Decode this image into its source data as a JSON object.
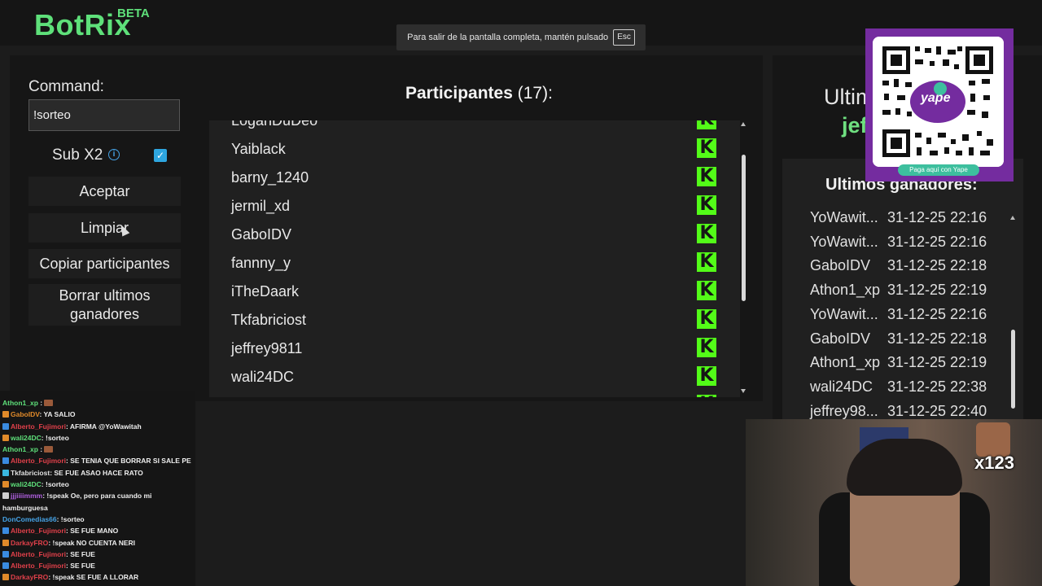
{
  "header": {
    "logo": "BotRix",
    "logo_badge": "BETA"
  },
  "fullscreen_notice": {
    "text": "Para salir de la pantalla completa, mantén pulsado",
    "key": "Esc"
  },
  "command": {
    "label": "Command:",
    "value": "!sorteo"
  },
  "sub_x2": {
    "label": "Sub X2",
    "info_icon": "info-icon",
    "checked": true
  },
  "buttons": {
    "aceptar": "Aceptar",
    "limpiar": "Limpiar",
    "copiar": "Copiar participantes",
    "borrar": "Borrar ultimos ganadores"
  },
  "participants": {
    "title": "Participantes",
    "count": "(17):",
    "items": [
      {
        "name": "LoganDuDeo"
      },
      {
        "name": "Yaiblack"
      },
      {
        "name": "barny_1240"
      },
      {
        "name": "jermil_xd"
      },
      {
        "name": "GaboIDV"
      },
      {
        "name": "fannny_y"
      },
      {
        "name": "iTheDaark"
      },
      {
        "name": "Tkfabriciost"
      },
      {
        "name": "jeffrey9811"
      },
      {
        "name": "wali24DC"
      }
    ],
    "platform_icon": "kick-icon",
    "platform_glyph": "K"
  },
  "right": {
    "ultim_heading": "Ultim",
    "winner_name": "jef"
  },
  "qr": {
    "pay_label": "Paga aquí con Yape",
    "brand": "yape"
  },
  "winners": {
    "title": "Ultimos ganadores:",
    "rows": [
      {
        "name": "YoWawit...",
        "date": "31-12-25 22:16"
      },
      {
        "name": "YoWawit...",
        "date": "31-12-25 22:16"
      },
      {
        "name": "GaboIDV",
        "date": "31-12-25 22:18"
      },
      {
        "name": "Athon1_xp",
        "date": "31-12-25 22:19"
      },
      {
        "name": "YoWawit...",
        "date": "31-12-25 22:16"
      },
      {
        "name": "GaboIDV",
        "date": "31-12-25 22:18"
      },
      {
        "name": "Athon1_xp",
        "date": "31-12-25 22:19"
      },
      {
        "name": "wali24DC",
        "date": "31-12-25 22:38"
      },
      {
        "name": "jeffrey98...",
        "date": "31-12-25 22:40"
      }
    ]
  },
  "chat": [
    {
      "user": "Athon1_xp",
      "color": "#5ee07a",
      "badge": "",
      "msg": "",
      "emote": true
    },
    {
      "user": "GaboIDV",
      "color": "#e08a2a",
      "badge": "orange",
      "msg": ": YA SALIO"
    },
    {
      "user": "Alberto_Fujimori",
      "color": "#e0404a",
      "badge": "blue",
      "msg": ": AFIRMA @YoWawitah"
    },
    {
      "user": "wali24DC",
      "color": "#5ee07a",
      "badge": "orange",
      "msg": ": !sorteo"
    },
    {
      "user": "Athon1_xp",
      "color": "#5ee07a",
      "badge": "",
      "msg": "",
      "emote": true
    },
    {
      "user": "Alberto_Fujimori",
      "color": "#e0404a",
      "badge": "blue",
      "msg": ": SE TENIA QUE BORRAR SI SALE PE"
    },
    {
      "user": "Tkfabriciost",
      "color": "#e0e0e0",
      "badge": "cyan",
      "msg": ": SE FUE ASAO HACE RATO"
    },
    {
      "user": "wali24DC",
      "color": "#5ee07a",
      "badge": "orange",
      "msg": ": !sorteo"
    },
    {
      "user": "jjjiiiimmm",
      "color": "#b060e0",
      "badge": "white",
      "msg": ": !speak Oe, pero para cuando mi"
    },
    {
      "user": "",
      "color": "#e0e0e0",
      "badge": "",
      "msg": "hamburguesa"
    },
    {
      "user": "DonComedias66",
      "color": "#46a3e6",
      "badge": "",
      "msg": ": !sorteo"
    },
    {
      "user": "Alberto_Fujimori",
      "color": "#e0404a",
      "badge": "blue",
      "msg": ": SE FUE MANO"
    },
    {
      "user": "DarkayFRO",
      "color": "#e0404a",
      "badge": "orange",
      "msg": ": !speak NO CUENTA NERI"
    },
    {
      "user": "Alberto_Fujimori",
      "color": "#e0404a",
      "badge": "blue",
      "msg": ": SE FUE"
    },
    {
      "user": "Alberto_Fujimori",
      "color": "#e0404a",
      "badge": "blue",
      "msg": ": SE FUE"
    },
    {
      "user": "DarkayFRO",
      "color": "#e0404a",
      "badge": "orange",
      "msg": ": !speak SE FUE A LLORAR"
    }
  ],
  "webcam": {
    "emote_count": "x123"
  }
}
